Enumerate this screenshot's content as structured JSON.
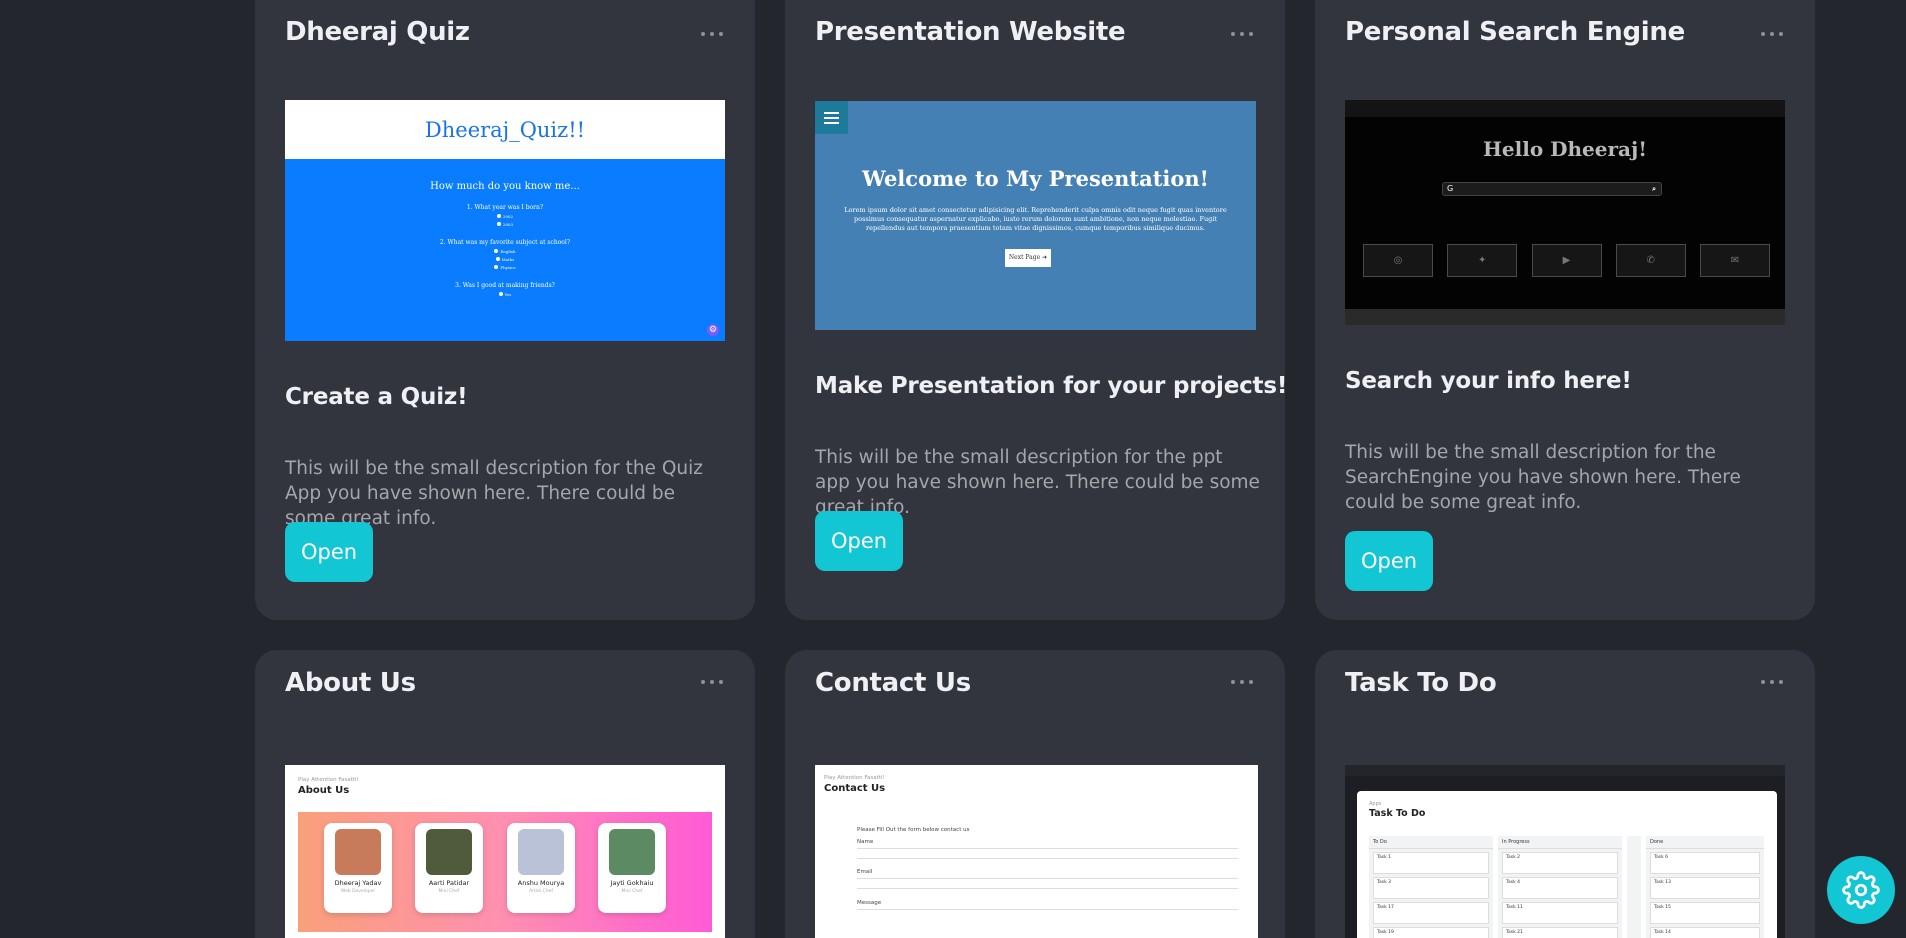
{
  "cards": [
    {
      "title": "Dheeraj Quiz",
      "subtitle": "Create a Quiz!",
      "description": "This will be the small description for the Quiz App you have shown here. There could be some great info.",
      "button": "Open",
      "preview": {
        "header": "Dheeraj_Quiz!!",
        "heading": "How much do you know me...",
        "q1": "1. What year was I born?",
        "q1_opts": [
          "2002",
          "2003"
        ],
        "q2": "2. What was my favorite subject at school?",
        "q2_opts": [
          "English",
          "Maths",
          "Physics"
        ],
        "q3": "3. Was I good at making friends?",
        "q3_opts": [
          "Yes",
          "No"
        ]
      }
    },
    {
      "title": "Presentation Website",
      "subtitle": "Make Presentation for your projects!",
      "description": "This will be the small description for the ppt app you have shown here. There could be some great info.",
      "button": "Open",
      "preview": {
        "heading": "Welcome to My Presentation!",
        "body": "Lorem ipsum dolor sit amet consectetur adipisicing elit. Reprehenderit culpa omnis odit neque fugit quas inventore possimus consequatur aspernatur explicabo, iusto rerum dolorem sunt ambitione, non neque molestiae. Fugit repellendus aut tempora praesentium totam vitae dignissimos, cumque temporibus similique ducimus.",
        "next": "Next Page"
      }
    },
    {
      "title": "Personal Search Engine",
      "subtitle": "Search your info here!",
      "description": "This will be the small description for the SearchEngine you have shown here. There could be some great info.",
      "button": "Open",
      "preview": {
        "heading": "Hello Dheeraj!",
        "search_prefix": "G",
        "icons": [
          "instagram-icon",
          "twitter-icon",
          "youtube-icon",
          "whatsapp-icon",
          "mail-icon"
        ]
      }
    },
    {
      "title": "About Us",
      "preview": {
        "small": "Play Attention Fasatti!",
        "heading": "About Us",
        "members": [
          {
            "name": "Dheeraj Yadav",
            "role": "Web Developer"
          },
          {
            "name": "Aarti Patidar",
            "role": "Mini Chef"
          },
          {
            "name": "Anshu Mourya",
            "role": "Artist Chef"
          },
          {
            "name": "Jayti Gokhaiu",
            "role": "Mini Chef"
          }
        ]
      }
    },
    {
      "title": "Contact Us",
      "preview": {
        "small": "Play Attention Fasatti!",
        "heading": "Contact Us",
        "intro": "Please Fill Out the form below contact us",
        "fields": [
          "Name",
          "Email",
          "Message"
        ]
      }
    },
    {
      "title": "Task To Do",
      "preview": {
        "small": "Apps",
        "heading": "Task To Do",
        "columns": [
          {
            "name": "To Do",
            "tasks": [
              "Task 1",
              "Task 3",
              "Task 17",
              "Task 19"
            ]
          },
          {
            "name": "In Progress",
            "tasks": [
              "Task 2",
              "Task 4",
              "Task 11",
              "Task 21"
            ]
          },
          {
            "name": "Done",
            "tasks": [
              "Task 6",
              "Task 13",
              "Task 15",
              "Task 14"
            ]
          }
        ]
      }
    }
  ],
  "colors": {
    "page_bg": "#24262d",
    "card_bg": "#32353d",
    "accent": "#12c6d4"
  },
  "fab": {
    "icon": "gear-icon"
  }
}
